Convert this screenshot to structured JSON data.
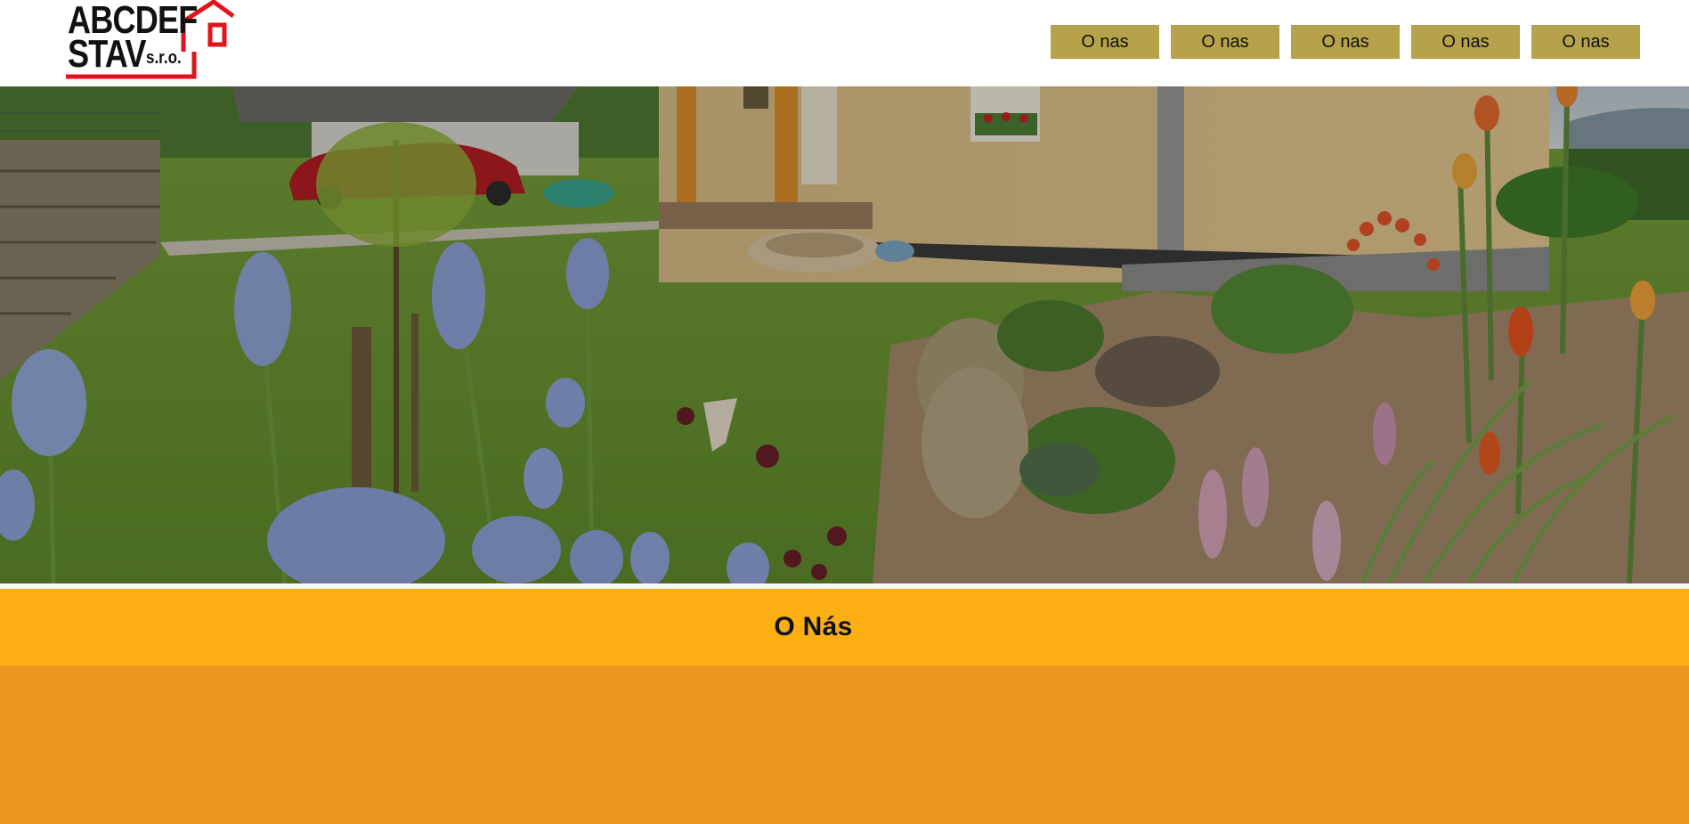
{
  "logo": {
    "line1": "ABCDEF",
    "line2": "STAV",
    "suffix": "s.r.o.",
    "icon": "house-icon",
    "accent_color": "#e1121b"
  },
  "nav": {
    "items": [
      {
        "label": "O nas"
      },
      {
        "label": "O nas"
      },
      {
        "label": "O nas"
      },
      {
        "label": "O nas"
      },
      {
        "label": "O nas"
      }
    ],
    "button_color": "#b5a24a"
  },
  "hero": {
    "subject": "house-garden-photo"
  },
  "section": {
    "title": "O Nás",
    "title_band_color": "#fbaf13",
    "content_band_color": "#ea9621"
  }
}
